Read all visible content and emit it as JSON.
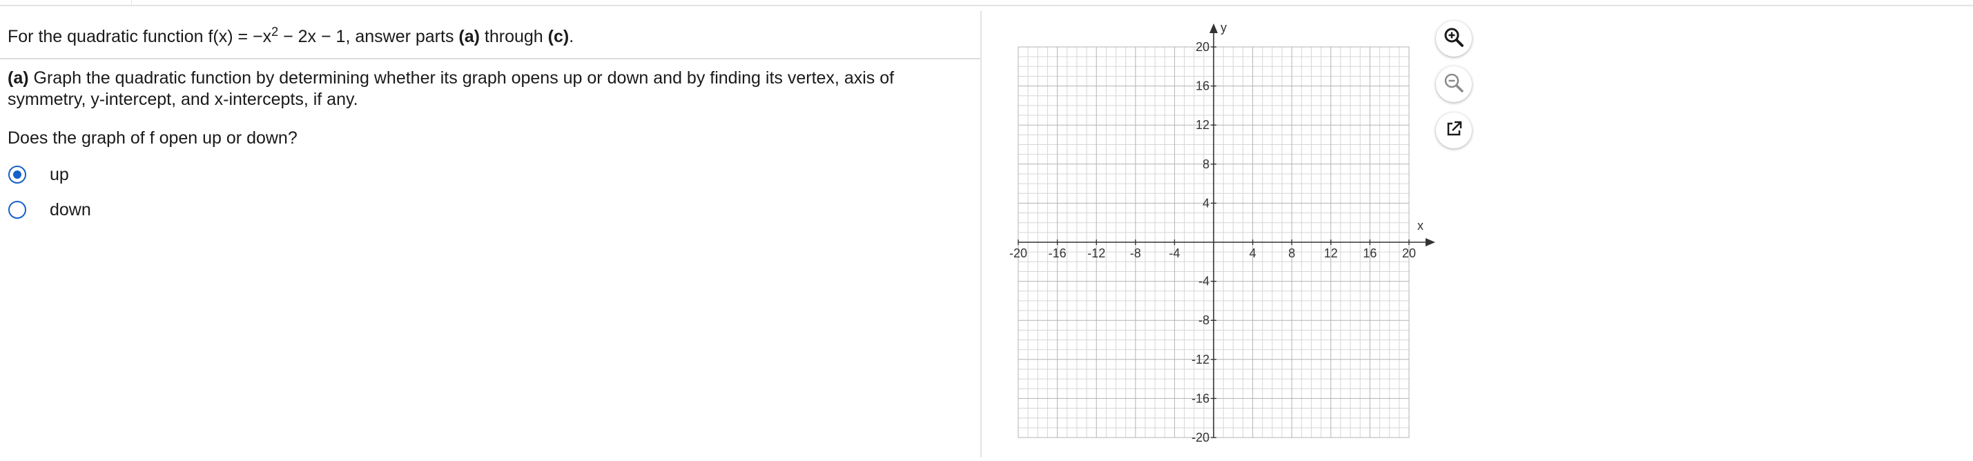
{
  "question": {
    "intro_prefix": "For the quadratic function f(x) = −x",
    "intro_exponent": "2",
    "intro_middle": " − 2x − 1, answer parts ",
    "intro_part_a": "(a)",
    "intro_through": " through ",
    "intro_part_c": "(c)",
    "intro_end": ".",
    "part_a_label": "(a)",
    "part_a_text": " Graph the quadratic function by determining whether its graph opens up or down and by finding its vertex, axis of symmetry, y-intercept, and x-intercepts, if any.",
    "prompt": "Does the graph of f open up or down?",
    "options": [
      {
        "label": "up",
        "selected": true
      },
      {
        "label": "down",
        "selected": false
      }
    ]
  },
  "graph": {
    "x_axis_label": "x",
    "y_axis_label": "y",
    "x_range": [
      -20,
      20
    ],
    "y_range": [
      -20,
      20
    ],
    "minor_step": 1,
    "major_step": 4,
    "x_tick_labels": [
      "-20",
      "-16",
      "-12",
      "-8",
      "-4",
      "4",
      "8",
      "12",
      "16",
      "20"
    ],
    "y_tick_labels": [
      "20",
      "16",
      "12",
      "8",
      "4",
      "-4",
      "-8",
      "-12",
      "-16",
      "-20"
    ]
  },
  "tools": {
    "icons": [
      "zoom-in-icon",
      "zoom-out-icon",
      "popout-icon"
    ]
  },
  "colors": {
    "accent": "#1560c9",
    "grid_minor": "#d6d6d6",
    "grid_major": "#b3b3b3",
    "axis": "#333333"
  }
}
